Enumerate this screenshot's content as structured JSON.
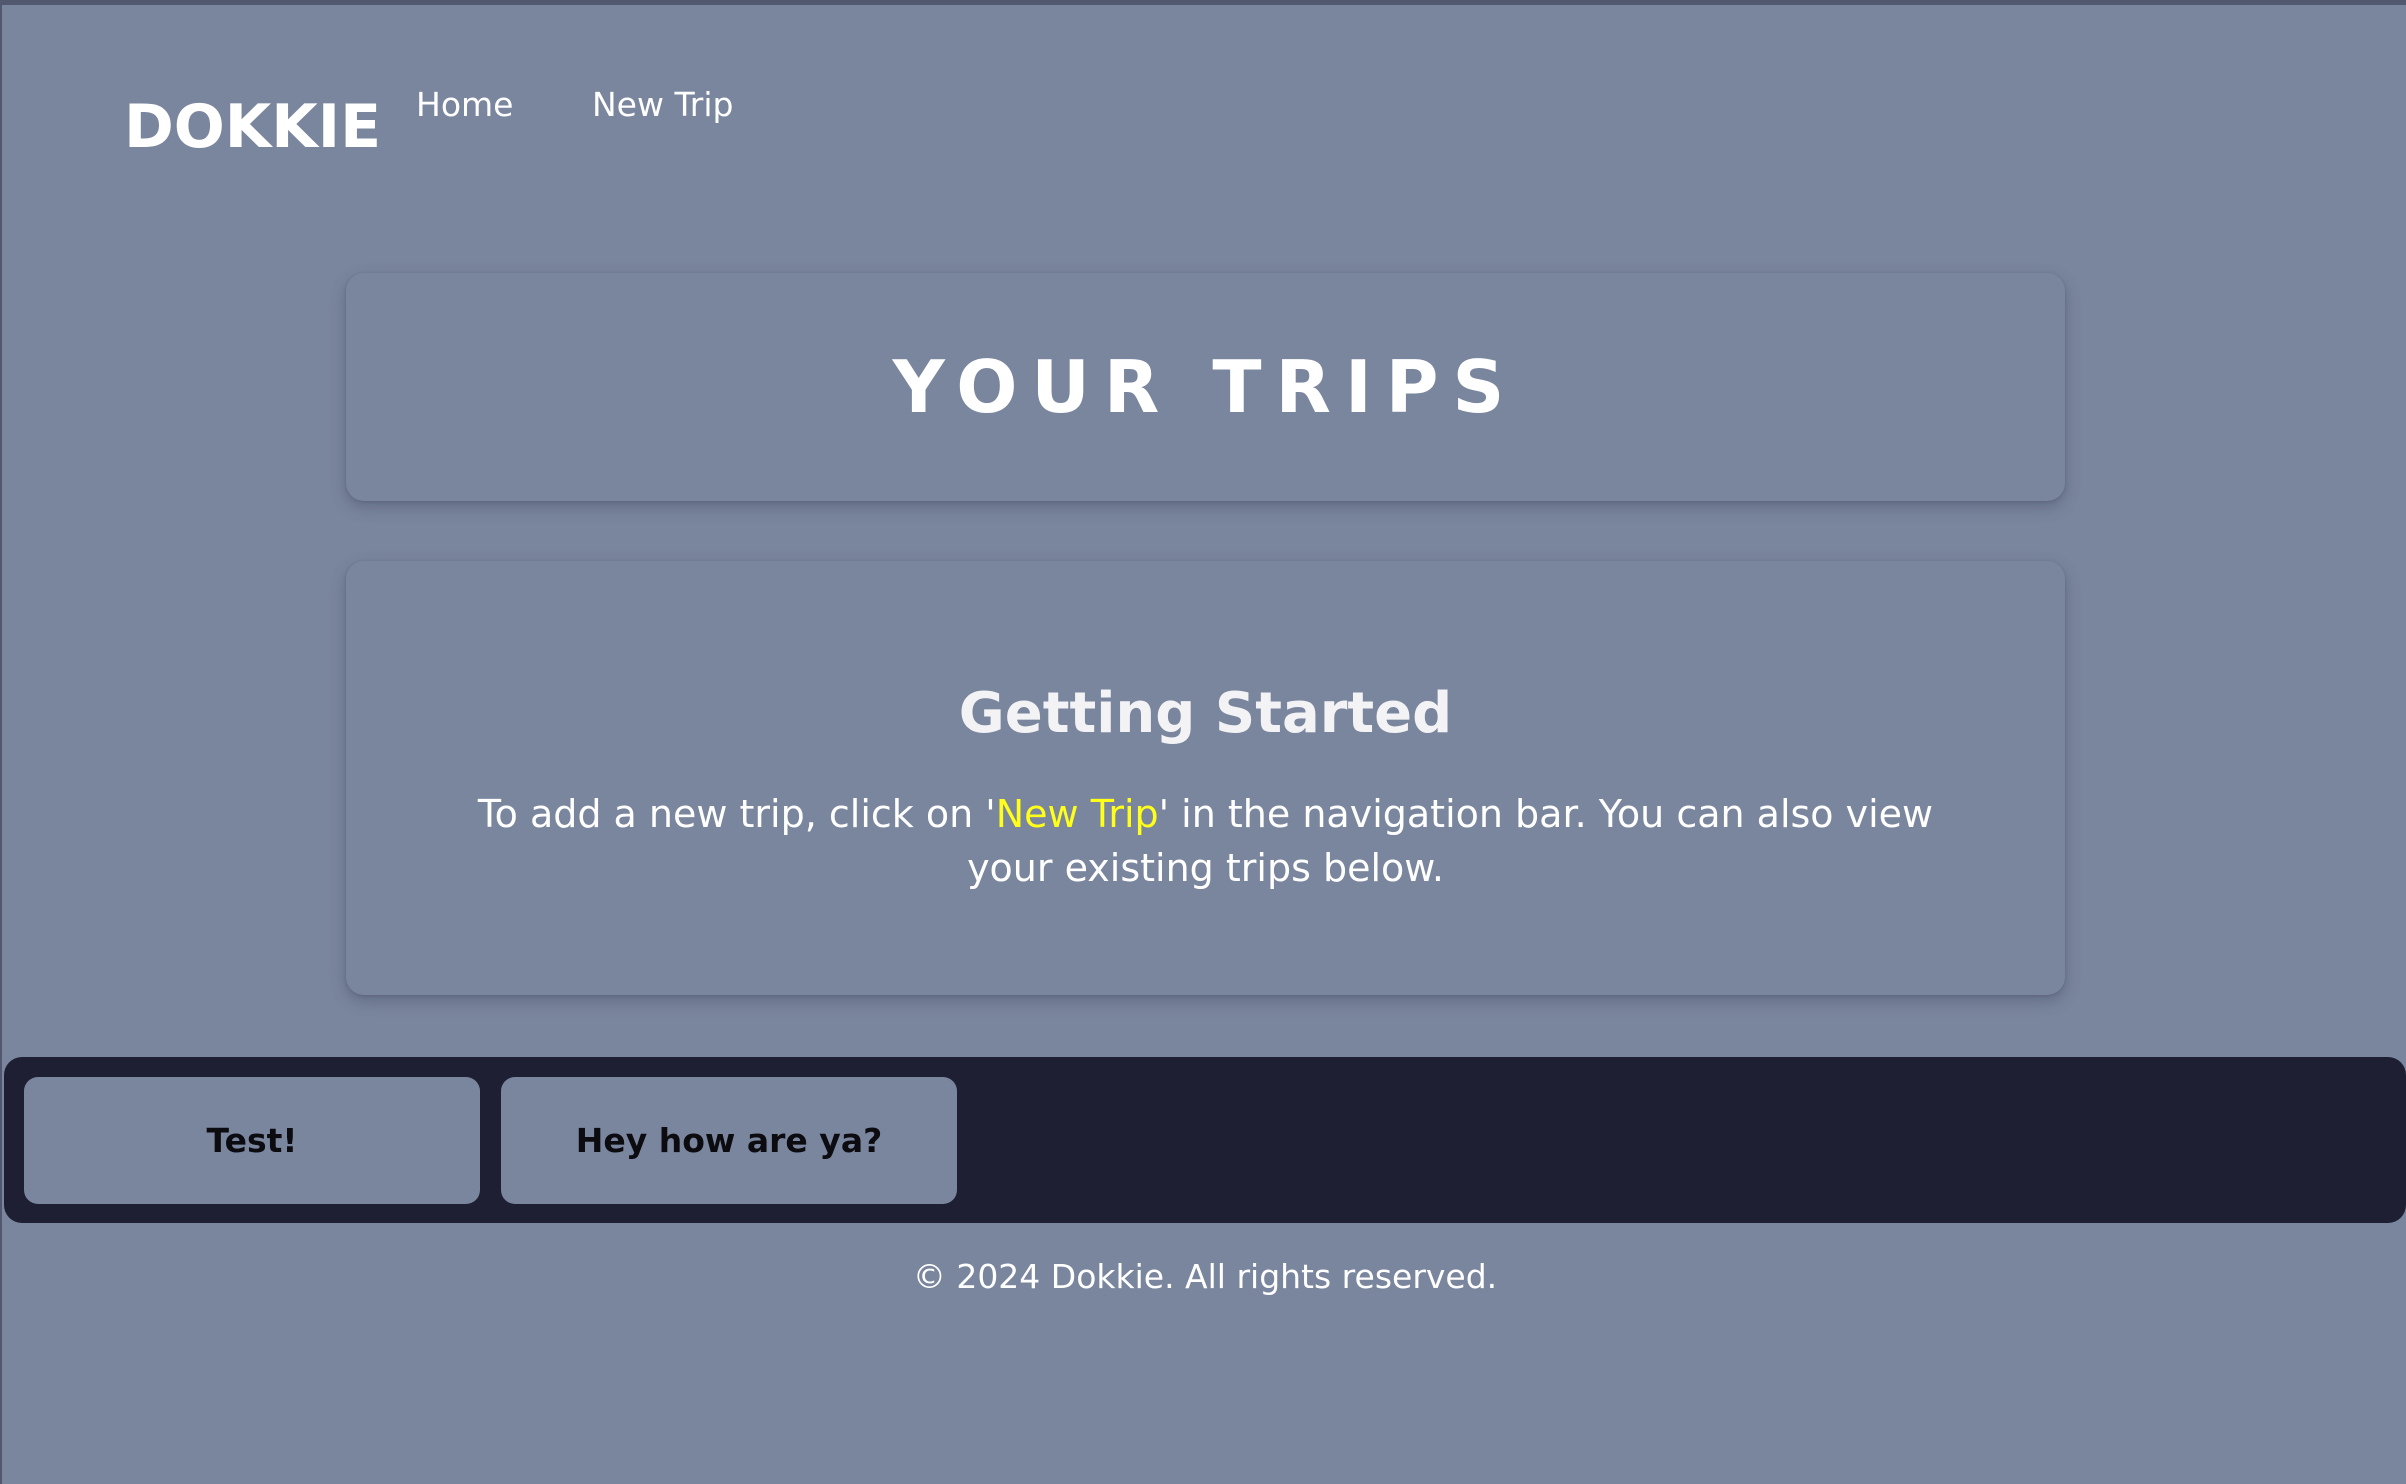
{
  "header": {
    "brand": "DOKKIE",
    "nav": {
      "home_label": "Home",
      "new_trip_label": "New Trip"
    }
  },
  "main": {
    "title": "YOUR TRIPS",
    "getting_started": {
      "heading": "Getting Started",
      "text_before": "To add a new trip, click on '",
      "highlight": "New Trip",
      "text_after": "' in the navigation bar. You can also view your existing trips below."
    }
  },
  "trips": [
    {
      "name": "Test!"
    },
    {
      "name": "Hey how are ya?"
    }
  ],
  "footer": {
    "copyright": "© 2024 Dokkie. All rights reserved."
  },
  "colors": {
    "background": "#7a869e",
    "trips_bar": "#1f1f33",
    "highlight": "#ffff1a",
    "text": "#ffffff"
  }
}
